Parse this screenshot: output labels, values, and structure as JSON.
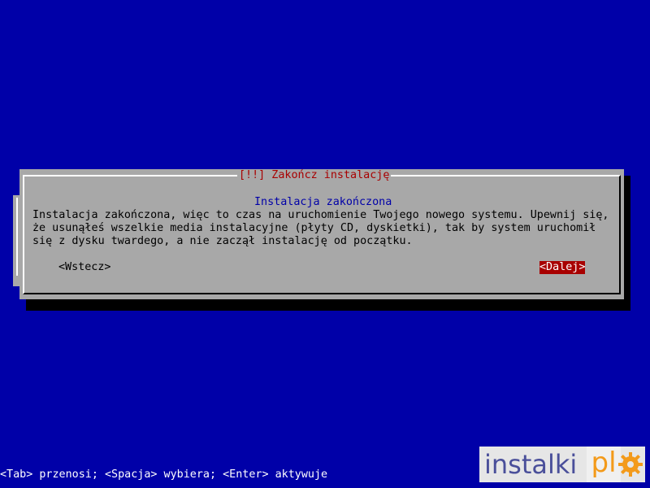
{
  "dialog": {
    "title": "[!!] Zakończ instalację",
    "subtitle": "Instalacja zakończona",
    "message": "Instalacja zakończona, więc to czas na uruchomienie Twojego nowego systemu. Upewnij się,\nże usunąłeś wszelkie media instalacyjne (płyty CD, dyskietki), tak by system uruchomił\nsię z dysku twardego, a nie zaczął instalację od początku.",
    "back_label": "<Wstecz>",
    "next_label": "<Dalej>"
  },
  "statusbar": {
    "text": "<Tab> przenosi; <Spacja> wybiera; <Enter> aktywuje"
  },
  "watermark": {
    "text": "instalki",
    "suffix": "pl",
    "icon": "gear-icon"
  },
  "colors": {
    "background": "#0000a8",
    "dialog": "#a8a8a8",
    "title": "#a80000",
    "selected_button_bg": "#a80000",
    "subtitle": "#0000a8",
    "logo_accent": "#f39a1a"
  }
}
